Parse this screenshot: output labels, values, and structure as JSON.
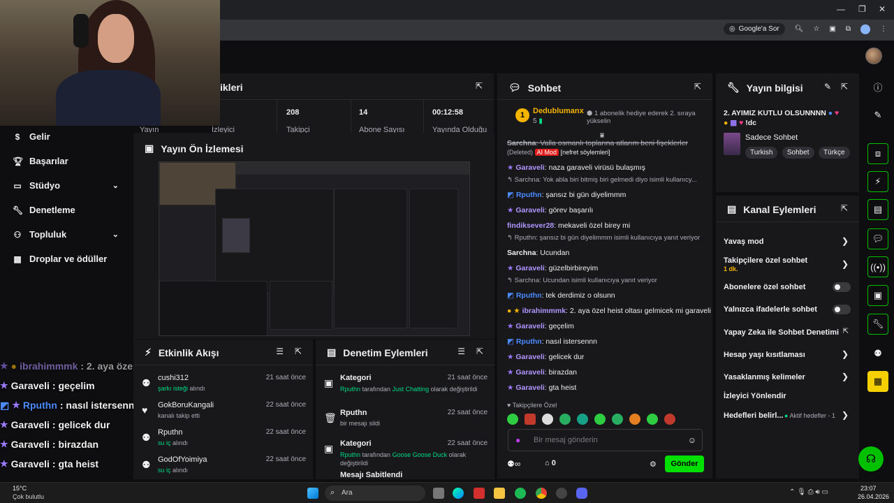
{
  "browser": {
    "google_ask": "Google'a Sor"
  },
  "nav": {
    "items": [
      {
        "label": "Gelir",
        "icon": "dollar-icon"
      },
      {
        "label": "Başarılar",
        "icon": "trophy-icon"
      },
      {
        "label": "Stüdyo",
        "icon": "studio-icon",
        "expandable": true
      },
      {
        "label": "Denetleme",
        "icon": "wrench-icon"
      },
      {
        "label": "Topluluk",
        "icon": "community-icon",
        "expandable": true
      },
      {
        "label": "Droplar ve ödüller",
        "icon": "gift-icon"
      }
    ]
  },
  "stats": {
    "title_fragment": "ikleri",
    "values": [
      "208",
      "14",
      "00:12:58"
    ],
    "labels": [
      "Yayın",
      "İzleyici",
      "Takipçi",
      "Abone Sayısı",
      "Yayında Olduğu"
    ]
  },
  "preview": {
    "title": "Yayın Ön İzlemesi"
  },
  "overlay_chat": [
    {
      "user": "ibrahimmmk",
      "text": ": 2. aya özel heist oltası gelmicek mi garaveli",
      "dim": true
    },
    {
      "user": "Garaveli",
      "text": ": geçelim"
    },
    {
      "user": "Rputhn",
      "text": ": nasıl istersennn"
    },
    {
      "user": "Garaveli",
      "text": ": gelicek dur"
    },
    {
      "user": "Garaveli",
      "text": ": birazdan"
    },
    {
      "user": "Garaveli",
      "text": ": gta heist"
    }
  ],
  "activity": {
    "title": "Etkinlik Akışı",
    "items": [
      {
        "name": "cushi312",
        "time": "21 saat önce",
        "highlight": "şarkı isteği",
        "rest": " alındı"
      },
      {
        "name": "GokBoruKangali",
        "time": "22 saat önce",
        "highlight": "",
        "rest": "kanalı takip etti"
      },
      {
        "name": "Rputhn",
        "time": "22 saat önce",
        "highlight": "su iç",
        "rest": " alındı"
      },
      {
        "name": "GodOfYoimiya",
        "time": "22 saat önce",
        "highlight": "su iç",
        "rest": " alındı"
      }
    ]
  },
  "moderation": {
    "title": "Denetim Eylemleri",
    "items": [
      {
        "title": "Kategori",
        "time": "21 saat önce",
        "who": "Rputhn",
        "mid": " tarafından ",
        "what": "Just Chatting",
        "tail": " olarak değiştirildi"
      },
      {
        "title": "Rputhn",
        "time": "22 saat önce",
        "who": "",
        "mid": "",
        "what": "",
        "tail": "bir mesajı sildi"
      },
      {
        "title": "Kategori",
        "time": "22 saat önce",
        "who": "Rputhn",
        "mid": " tarafından ",
        "what": "Goose Goose Duck",
        "tail": " olarak değiştirildi"
      },
      {
        "title": "Mesajı Sabitlendi",
        "time": "",
        "who": "",
        "mid": "",
        "what": "",
        "tail": ""
      }
    ]
  },
  "chat": {
    "title": "Sohbet",
    "gift_user": "Dedublumanx",
    "gift_count": "5",
    "gift_text": "1 abonelik hediye ederek 2. sıraya yükselin",
    "deleted_line": {
      "user": "Sarchna",
      "text": ": Valla osmanlı toplarına atlarım beni fişeklerler",
      "deleted": "(Deleted)",
      "ai": "AI Mod",
      "reason": "[nefret söylemleri]"
    },
    "lines": [
      {
        "type": "msg",
        "badge": "star",
        "user": "Garaveli",
        "cls": "u-g",
        "text": ": naza garaveli virüsü bulaşmış"
      },
      {
        "type": "reply",
        "text": "Sarchna: Yok abla biri bitmiş biri gelmedi diyo isimli kullanıcy..."
      },
      {
        "type": "msg",
        "badge": "star2",
        "user": "Rputhn",
        "cls": "u-r",
        "text": ": şansız bi gün diyelimmm"
      },
      {
        "type": "msg",
        "badge": "star",
        "user": "Garaveli",
        "cls": "u-g",
        "text": ": görev başarılı"
      },
      {
        "type": "msg",
        "badge": "",
        "user": "findiksever28",
        "cls": "u-f",
        "text": ": mekaveli özel birey mi"
      },
      {
        "type": "reply",
        "text": "Rputhn: şansız bi gün diyelimmm isimli kullanıcıya yanıt veriyor"
      },
      {
        "type": "msg",
        "badge": "",
        "user": "Sarchna",
        "cls": "u-s",
        "text": ": Ucundan"
      },
      {
        "type": "msg",
        "badge": "star",
        "user": "Garaveli",
        "cls": "u-g",
        "text": ": güzelbirbireyim"
      },
      {
        "type": "reply",
        "text": "Sarchna: Ucundan isimli kullanıcıya yanıt veriyor"
      },
      {
        "type": "msg",
        "badge": "star2",
        "user": "Rputhn",
        "cls": "u-r",
        "text": ": tek derdimiz o olsunn"
      },
      {
        "type": "msg",
        "badge": "gold",
        "user": "ibrahimmmk",
        "cls": "u-g",
        "text": ": 2. aya özel heist oltası gelmicek mi garaveli"
      },
      {
        "type": "msg",
        "badge": "star",
        "user": "Garaveli",
        "cls": "u-g",
        "text": ": geçelim"
      },
      {
        "type": "msg",
        "badge": "star2",
        "user": "Rputhn",
        "cls": "u-r",
        "text": ": nasıl istersennn"
      },
      {
        "type": "msg",
        "badge": "star",
        "user": "Garaveli",
        "cls": "u-g",
        "text": ": gelicek dur"
      },
      {
        "type": "msg",
        "badge": "star",
        "user": "Garaveli",
        "cls": "u-g",
        "text": ": birazdan"
      },
      {
        "type": "msg",
        "badge": "star",
        "user": "Garaveli",
        "cls": "u-g",
        "text": ": gta heist"
      }
    ],
    "followers_only": "Takipçilere Özel",
    "input_placeholder": "Bir mesaj gönderin",
    "points": "0",
    "send_label": "Gönder"
  },
  "info": {
    "title": "Yayın bilgisi",
    "stream_title": "2. AYIMIZ KUTLU OLSUNNNN",
    "stream_title_tail": "!dc",
    "category": "Sadece Sohbet",
    "tags": [
      "Turkish",
      "Sohbet",
      "Türkçe"
    ]
  },
  "actions": {
    "title": "Kanal Eylemleri",
    "items": [
      {
        "label": "Yavaş mod",
        "kind": "chev"
      },
      {
        "label": "Takipçilere özel sohbet",
        "sub": "1 dk.",
        "kind": "chev"
      },
      {
        "label": "Abonelere özel sohbet",
        "kind": "toggle"
      },
      {
        "label": "Yalnızca ifadelerle sohbet",
        "kind": "toggle"
      },
      {
        "label": "Yapay Zeka ile Sohbet Denetimi",
        "kind": "ext"
      },
      {
        "label": "Hesap yaşı kısıtlaması",
        "kind": "chev"
      },
      {
        "label": "Yasaklanmış kelimeler",
        "kind": "chev"
      },
      {
        "label": "İzleyici Yönlendir",
        "kind": "none"
      },
      {
        "label": "Hedefleri belirl...",
        "sub2": "Aktif hedefler - 1",
        "kind": "chev"
      }
    ]
  },
  "taskbar": {
    "weather_temp": "15°C",
    "weather_desc": "Çok bulutlu",
    "search": "Ara",
    "time": "23:07",
    "date": "26.04.2026"
  },
  "colors": {
    "accent_green": "#00e000",
    "purple": "#9b7bff",
    "panel": "#18181b",
    "bg": "#0e0e10"
  }
}
